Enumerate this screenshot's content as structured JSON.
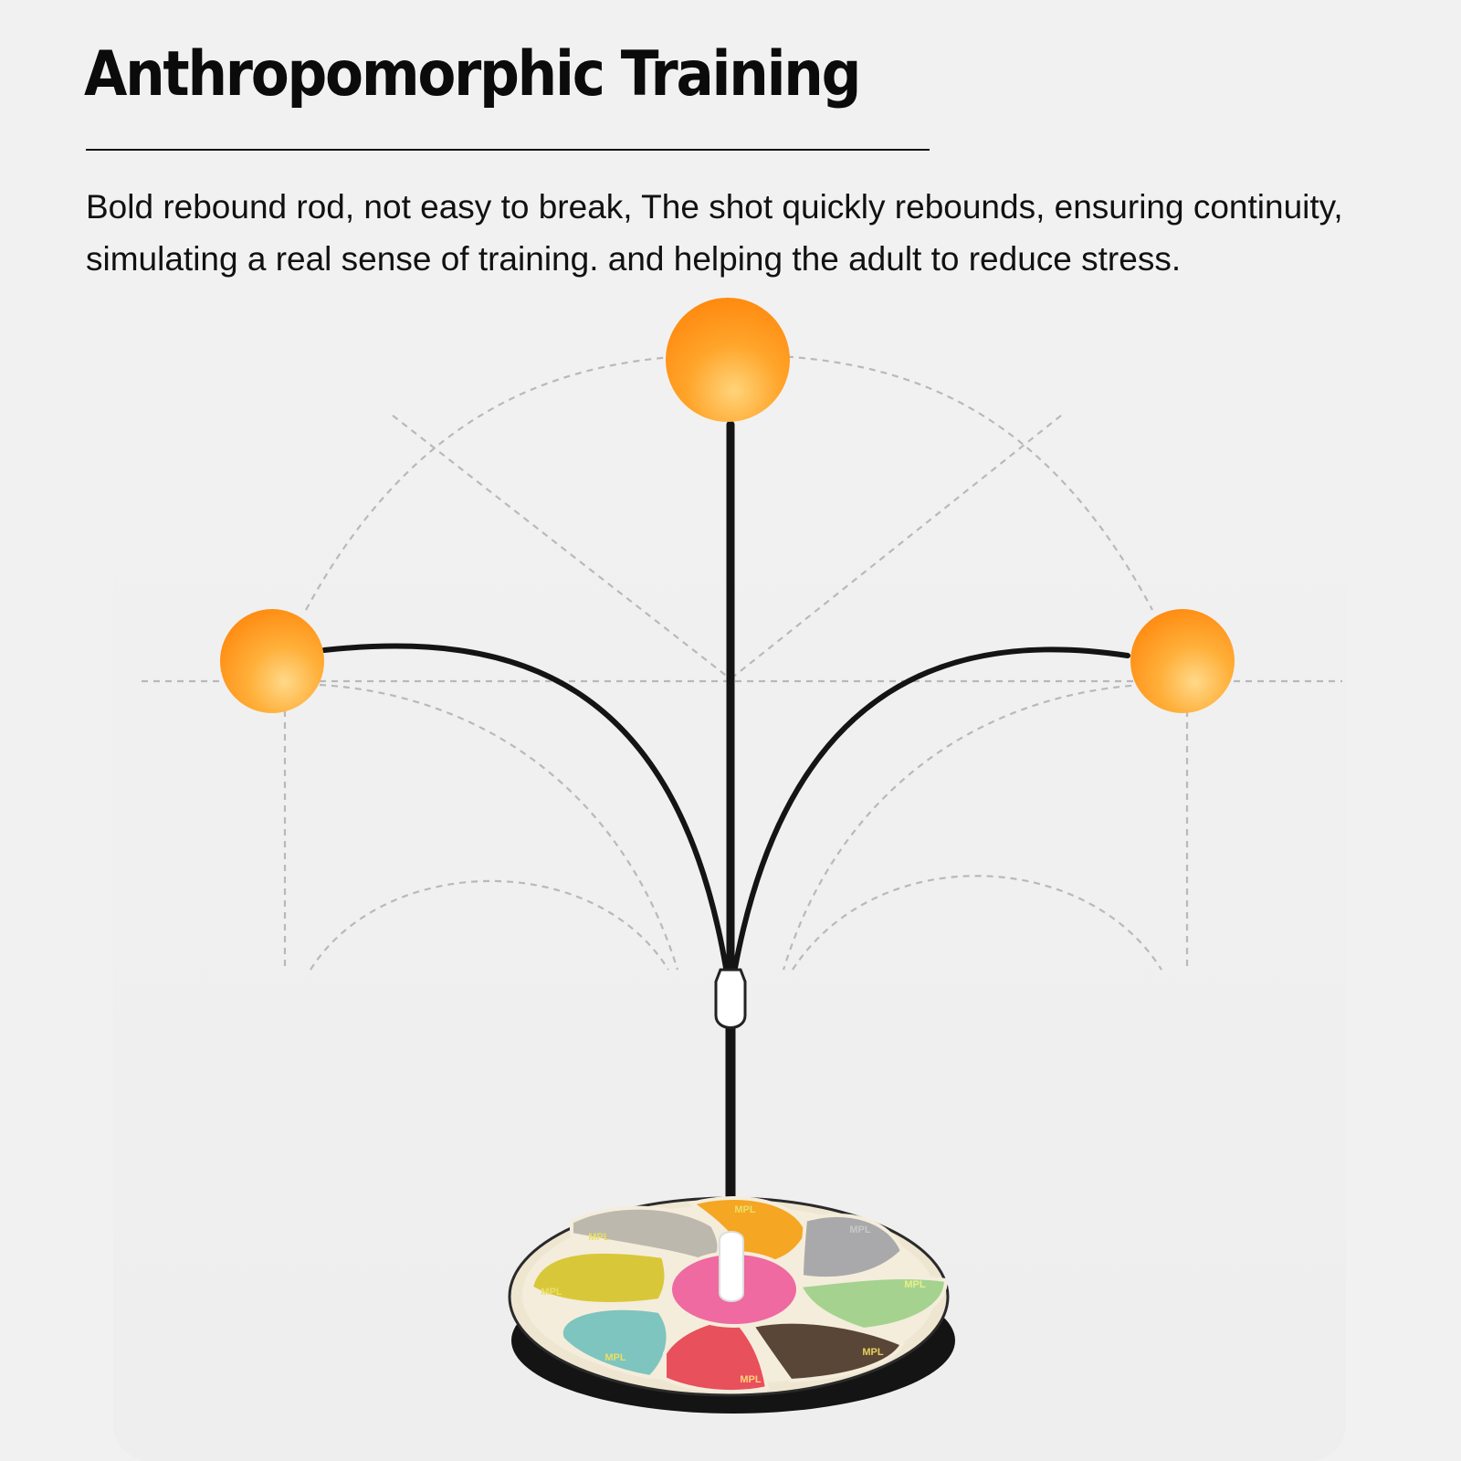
{
  "header": {
    "title": "Anthropomorphic Training",
    "description": "Bold rebound rod, not easy to break, The shot quickly rebounds, ensuring continuity, simulating a real sense of training. and helping the adult to reduce stress."
  },
  "illustration": {
    "base_label": "MPL",
    "colors": {
      "background": "#f1f1f1",
      "ball_orange": "#ff9a1a",
      "rod": "#111111",
      "guide_lines": "#b9b9b9",
      "segments": [
        "#f5a623",
        "#a8a8a8",
        "#c9c9c9",
        "#d8c93a",
        "#9ccc8a",
        "#7ec4bf",
        "#e8505b",
        "#5a4636"
      ],
      "hub": "#ee6aa0"
    }
  }
}
